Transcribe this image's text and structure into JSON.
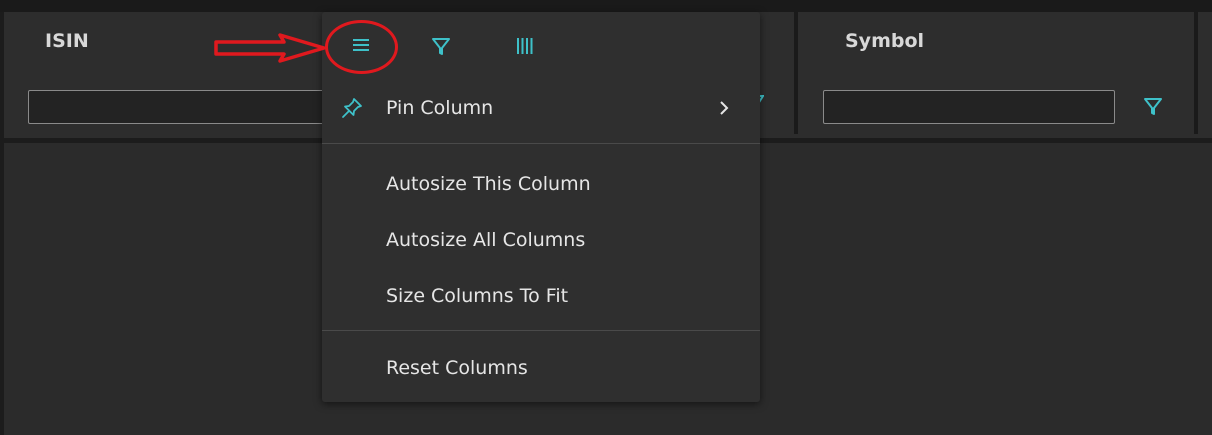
{
  "grid": {
    "columns": [
      {
        "id": "isin",
        "header": "ISIN",
        "filter_value": ""
      },
      {
        "id": "symbol",
        "header": "Symbol",
        "filter_value": ""
      }
    ]
  },
  "column_menu": {
    "tabs": [
      {
        "name": "general-tab",
        "icon": "menu-icon",
        "active": true
      },
      {
        "name": "filter-tab",
        "icon": "filter-icon",
        "active": false
      },
      {
        "name": "columns-tab",
        "icon": "columns-icon",
        "active": false
      }
    ],
    "items": [
      {
        "label": "Pin Column",
        "icon": "pin-icon",
        "has_submenu": true
      },
      {
        "label": "Autosize This Column"
      },
      {
        "label": "Autosize All Columns"
      },
      {
        "label": "Size Columns To Fit"
      },
      {
        "label": "Reset Columns"
      }
    ]
  },
  "annotation": {
    "color": "#e0191e",
    "shapes": [
      "arrow",
      "circle"
    ]
  },
  "colors": {
    "accent": "#3ec1c9",
    "background": "#2b2b2b",
    "menu_background": "#2f2f2f"
  }
}
